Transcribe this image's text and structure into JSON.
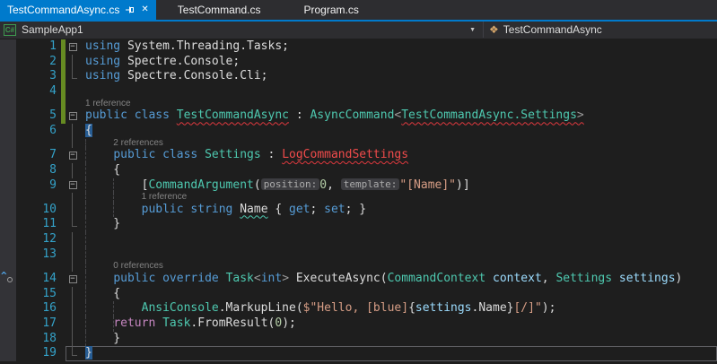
{
  "tabs": [
    {
      "label": "TestCommandAsync.cs",
      "active": true,
      "icons": [
        "pin-icon",
        "close-icon"
      ]
    },
    {
      "label": "TestCommand.cs",
      "active": false
    },
    {
      "label": "Program.cs",
      "active": false
    }
  ],
  "navbar": {
    "project_icon": "C#",
    "project_label": "SampleApp1",
    "type_icon": "class-icon",
    "type_label": "TestCommandAsync",
    "dropdown_icon": "chevron-down-icon"
  },
  "colors": {
    "accent_blue": "#007ACC",
    "editor_bg": "#1E1E1E",
    "tabstrip_bg": "#2D2D30",
    "glyph_margin_bg": "#333337",
    "keyword": "#569CD6",
    "control_keyword": "#C586C0",
    "type": "#4EC9B0",
    "string": "#D69D85",
    "number": "#B5CEA8",
    "error_red": "#F14B4B",
    "parameter": "#9CDCFE",
    "plain_text": "#DCDCDC",
    "line_number": "#34A2C9",
    "codelens": "#848484",
    "changed_bar_green": "#668B22",
    "brace_match_bg": "#275D94"
  },
  "editor": {
    "rows": [
      {
        "k": "c",
        "n": 1,
        "f": "box",
        "ch": true,
        "t": [
          [
            "kw",
            "using"
          ],
          [
            "d",
            " System.Threading.Tasks;"
          ]
        ]
      },
      {
        "k": "c",
        "n": 2,
        "f": "vline",
        "ch": true,
        "t": [
          [
            "kw",
            "using"
          ],
          [
            "d",
            " Spectre.Console;"
          ]
        ]
      },
      {
        "k": "c",
        "n": 3,
        "f": "end",
        "ch": true,
        "t": [
          [
            "kw",
            "using"
          ],
          [
            "d",
            " Spectre.Console.Cli;"
          ]
        ]
      },
      {
        "k": "c",
        "n": 4,
        "f": "",
        "ch": true,
        "t": []
      },
      {
        "k": "l",
        "ch": true,
        "ind": 0,
        "s": "1 reference"
      },
      {
        "k": "c",
        "n": 5,
        "f": "box",
        "ch": true,
        "t": [
          [
            "kw",
            "public"
          ],
          [
            "d",
            " "
          ],
          [
            "kw",
            "class"
          ],
          [
            "d",
            " "
          ],
          [
            "tyE",
            "TestCommandAsync"
          ],
          [
            "d",
            " : "
          ],
          [
            "ty",
            "AsyncCommand"
          ],
          [
            "pu",
            "<"
          ],
          [
            "tyE",
            "TestCommandAsync.Settings"
          ],
          [
            "puE",
            ">"
          ]
        ]
      },
      {
        "k": "c",
        "n": 6,
        "f": "vline",
        "t": [
          [
            "match",
            "{"
          ]
        ]
      },
      {
        "k": "l",
        "ind": 4,
        "s": "2 references",
        "g": [
          0
        ],
        "f": "vline"
      },
      {
        "k": "c",
        "n": 7,
        "f": "box",
        "g": [
          0
        ],
        "t": [
          [
            "d",
            "    "
          ],
          [
            "kw",
            "public"
          ],
          [
            "d",
            " "
          ],
          [
            "kw",
            "class"
          ],
          [
            "d",
            " "
          ],
          [
            "ty",
            "Settings"
          ],
          [
            "d",
            " : "
          ],
          [
            "err",
            "LogCommandSettings"
          ]
        ]
      },
      {
        "k": "c",
        "n": 8,
        "f": "vline",
        "g": [
          0
        ],
        "t": [
          [
            "d",
            "    {"
          ]
        ]
      },
      {
        "k": "c",
        "n": 9,
        "f": "box",
        "g": [
          0,
          1
        ],
        "t": [
          [
            "d",
            "        ["
          ],
          [
            "ty",
            "CommandArgument"
          ],
          [
            "d",
            "("
          ],
          [
            "hint",
            "position:"
          ],
          [
            "num",
            "0"
          ],
          [
            "d",
            ", "
          ],
          [
            "hint",
            "template:"
          ],
          [
            "str",
            "\"[Name]\""
          ],
          [
            "d",
            ")]"
          ]
        ]
      },
      {
        "k": "l",
        "ind": 8,
        "s": "1 reference",
        "g": [
          0,
          1
        ],
        "f": "vline"
      },
      {
        "k": "c",
        "n": 10,
        "f": "vline",
        "g": [
          0,
          1
        ],
        "t": [
          [
            "d",
            "        "
          ],
          [
            "kw",
            "public"
          ],
          [
            "d",
            " "
          ],
          [
            "kw",
            "string"
          ],
          [
            "d",
            " "
          ],
          [
            "dS",
            "Name"
          ],
          [
            "d",
            " { "
          ],
          [
            "kw",
            "get"
          ],
          [
            "d",
            "; "
          ],
          [
            "kw",
            "set"
          ],
          [
            "d",
            "; }"
          ]
        ]
      },
      {
        "k": "c",
        "n": 11,
        "f": "end",
        "g": [
          0
        ],
        "t": [
          [
            "d",
            "    }"
          ]
        ]
      },
      {
        "k": "c",
        "n": 12,
        "f": "vline",
        "g": [
          0
        ],
        "t": []
      },
      {
        "k": "c",
        "n": 13,
        "f": "vline",
        "g": [
          0
        ],
        "t": []
      },
      {
        "k": "l",
        "ind": 4,
        "s": "0 references",
        "g": [
          0
        ],
        "f": "vline"
      },
      {
        "k": "c",
        "n": 14,
        "f": "box",
        "g": [
          0
        ],
        "glyph": "caret-circle",
        "t": [
          [
            "d",
            "    "
          ],
          [
            "kw",
            "public"
          ],
          [
            "d",
            " "
          ],
          [
            "kw",
            "override"
          ],
          [
            "d",
            " "
          ],
          [
            "ty",
            "Task"
          ],
          [
            "pu",
            "<"
          ],
          [
            "kw",
            "int"
          ],
          [
            "pu",
            ">"
          ],
          [
            "d",
            " "
          ],
          [
            "m",
            "ExecuteAsync"
          ],
          [
            "d",
            "("
          ],
          [
            "ty",
            "CommandContext"
          ],
          [
            "d",
            " "
          ],
          [
            "par",
            "context"
          ],
          [
            "d",
            ", "
          ],
          [
            "ty",
            "Settings"
          ],
          [
            "d",
            " "
          ],
          [
            "par",
            "settings"
          ],
          [
            "d",
            ")"
          ]
        ]
      },
      {
        "k": "c",
        "n": 15,
        "f": "vline",
        "g": [
          0
        ],
        "t": [
          [
            "d",
            "    {"
          ]
        ]
      },
      {
        "k": "c",
        "n": 16,
        "f": "vline",
        "g": [
          0,
          1
        ],
        "t": [
          [
            "d",
            "        "
          ],
          [
            "ty",
            "AnsiConsole"
          ],
          [
            "d",
            "."
          ],
          [
            "m",
            "MarkupLine"
          ],
          [
            "d",
            "("
          ],
          [
            "str",
            "$\"Hello, [blue]"
          ],
          [
            "d",
            "{"
          ],
          [
            "par",
            "settings"
          ],
          [
            "d",
            ".Name}"
          ],
          [
            "str",
            "[/]\""
          ],
          [
            "d",
            ");"
          ]
        ]
      },
      {
        "k": "c",
        "n": 17,
        "f": "vline",
        "g": [
          0,
          1
        ],
        "t": [
          [
            "d",
            "    "
          ],
          [
            "ctrl",
            "return"
          ],
          [
            "d",
            " "
          ],
          [
            "ty",
            "Task"
          ],
          [
            "d",
            "."
          ],
          [
            "m",
            "FromResult"
          ],
          [
            "d",
            "("
          ],
          [
            "num",
            "0"
          ],
          [
            "d",
            ");"
          ]
        ]
      },
      {
        "k": "c",
        "n": 18,
        "f": "vline",
        "g": [
          0
        ],
        "t": [
          [
            "d",
            "    }"
          ]
        ]
      },
      {
        "k": "c",
        "n": 19,
        "f": "end",
        "cur": true,
        "t": [
          [
            "match",
            "}"
          ]
        ]
      }
    ]
  }
}
